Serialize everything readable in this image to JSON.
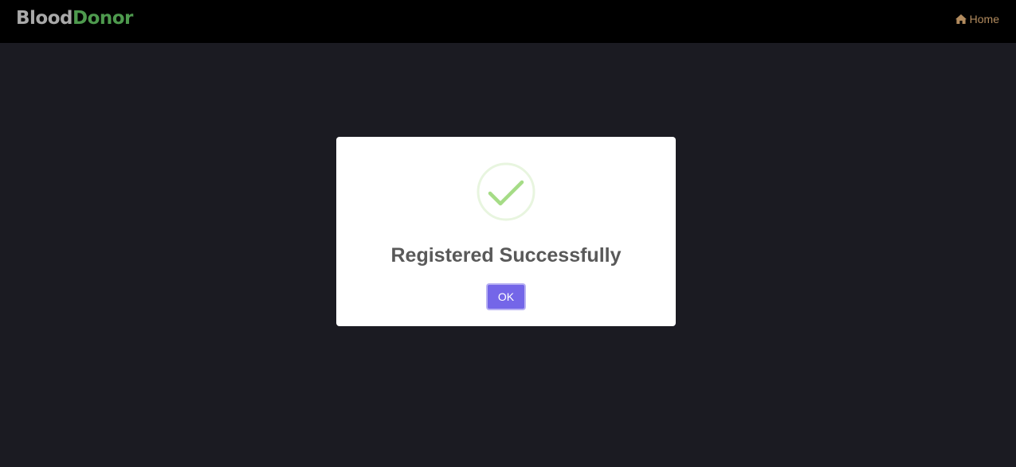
{
  "app": {
    "brand_part1": "Blood",
    "brand_part2": "Donor"
  },
  "nav": {
    "home_label": "Home",
    "home_icon": "home-icon"
  },
  "dialog": {
    "icon": "success-check-icon",
    "title": "Registered Successfully",
    "ok_label": "OK"
  },
  "colors": {
    "navbar_bg": "#000000",
    "page_bg": "#1b1b22",
    "brand_gray": "#a9a9a9",
    "brand_green": "#4e9a4e",
    "nav_link": "#b28b5e",
    "success_green": "#a5dc86",
    "button": "#7466e8"
  }
}
